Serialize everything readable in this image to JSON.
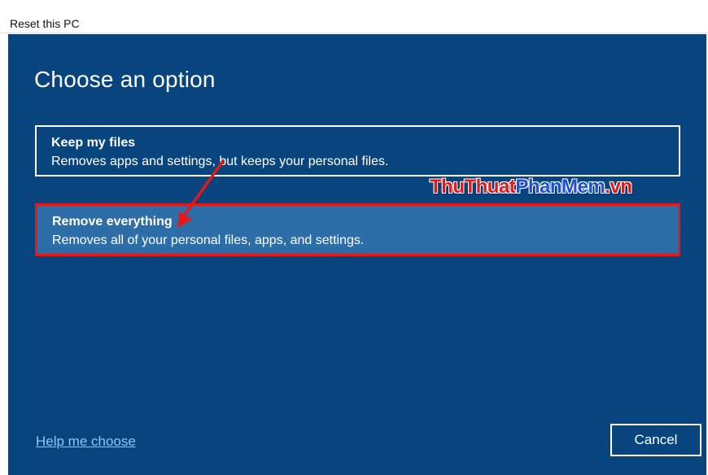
{
  "window": {
    "title": "Reset this PC"
  },
  "main": {
    "heading": "Choose an option",
    "options": [
      {
        "title": "Keep my files",
        "description": "Removes apps and settings, but keeps your personal files."
      },
      {
        "title": "Remove everything",
        "description": "Removes all of your personal files, apps, and settings."
      }
    ]
  },
  "watermark": {
    "part1": "ThuThuat",
    "part2": "PhanMem",
    "part3": ".vn"
  },
  "footer": {
    "help_link": "Help me choose",
    "cancel_label": "Cancel"
  },
  "colors": {
    "background": "#08457f",
    "selected_option": "#2d6ea8",
    "highlight_border": "#e61818",
    "link": "#8cc4ff"
  }
}
